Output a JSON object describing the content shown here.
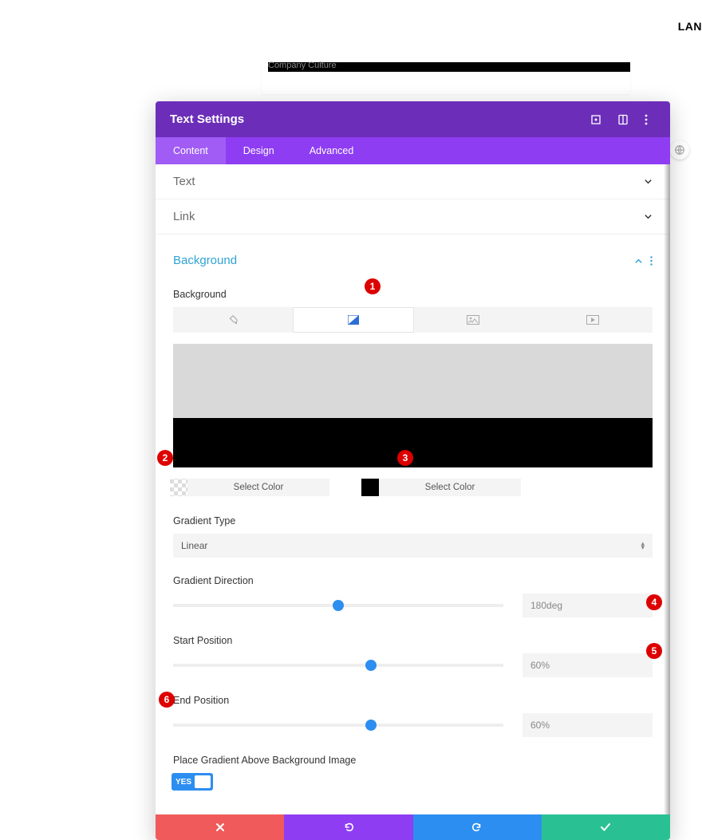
{
  "topnav": {
    "label": "LAN"
  },
  "background_row": {
    "text": "Company Culture"
  },
  "modal": {
    "title": "Text Settings",
    "tabs": [
      {
        "label": "Content",
        "active": true
      },
      {
        "label": "Design",
        "active": false
      },
      {
        "label": "Advanced",
        "active": false
      }
    ],
    "sections": {
      "text": {
        "title": "Text"
      },
      "link": {
        "title": "Link"
      },
      "background": {
        "title": "Background"
      }
    },
    "bg": {
      "label": "Background",
      "select_color_1": "Select Color",
      "select_color_2": "Select Color",
      "gradient_type_label": "Gradient Type",
      "gradient_type": "Linear",
      "direction_label": "Gradient Direction",
      "direction_value": "180deg",
      "direction_pct": 50,
      "start_label": "Start Position",
      "start_value": "60%",
      "start_pct": 60,
      "end_label": "End Position",
      "end_value": "60%",
      "end_pct": 60,
      "above_label": "Place Gradient Above Background Image",
      "above_toggle": "YES"
    }
  },
  "badges": [
    "1",
    "2",
    "3",
    "4",
    "5",
    "6"
  ]
}
